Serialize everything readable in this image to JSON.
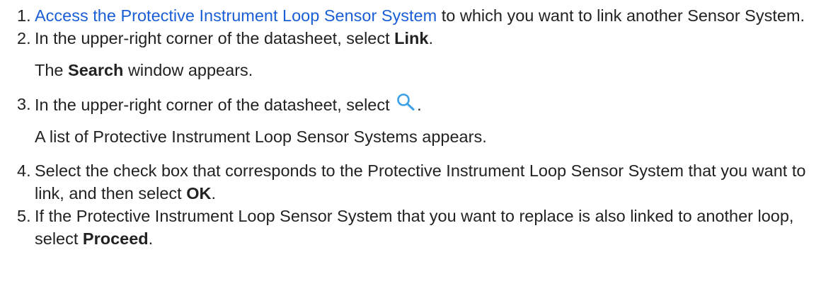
{
  "steps": [
    {
      "number": "1.",
      "link_text": "Access the Protective Instrument Loop Sensor System",
      "text_after": " to which you want to link another Sensor System."
    },
    {
      "number": "2.",
      "text_before": "In the upper-right corner of the datasheet, select ",
      "bold": "Link",
      "text_after": ".",
      "result": {
        "text_before": "The ",
        "bold": "Search",
        "text_after": " window appears."
      }
    },
    {
      "number": "3.",
      "text_before": "In the upper-right corner of the datasheet, select ",
      "icon": "search-icon",
      "text_after": ".",
      "result": {
        "text": "A list of Protective Instrument Loop Sensor Systems appears."
      }
    },
    {
      "number": "4.",
      "text_before": "Select the check box that corresponds to the Protective Instrument Loop Sensor System that you want to link, and then select ",
      "bold": "OK",
      "text_after": "."
    },
    {
      "number": "5.",
      "text_before": "If the Protective Instrument Loop Sensor System that you want to replace is also linked to another loop, select ",
      "bold": "Proceed",
      "text_after": "."
    }
  ],
  "colors": {
    "text": "#222222",
    "link": "#1a5fd6",
    "icon": "#3aa0e8"
  }
}
